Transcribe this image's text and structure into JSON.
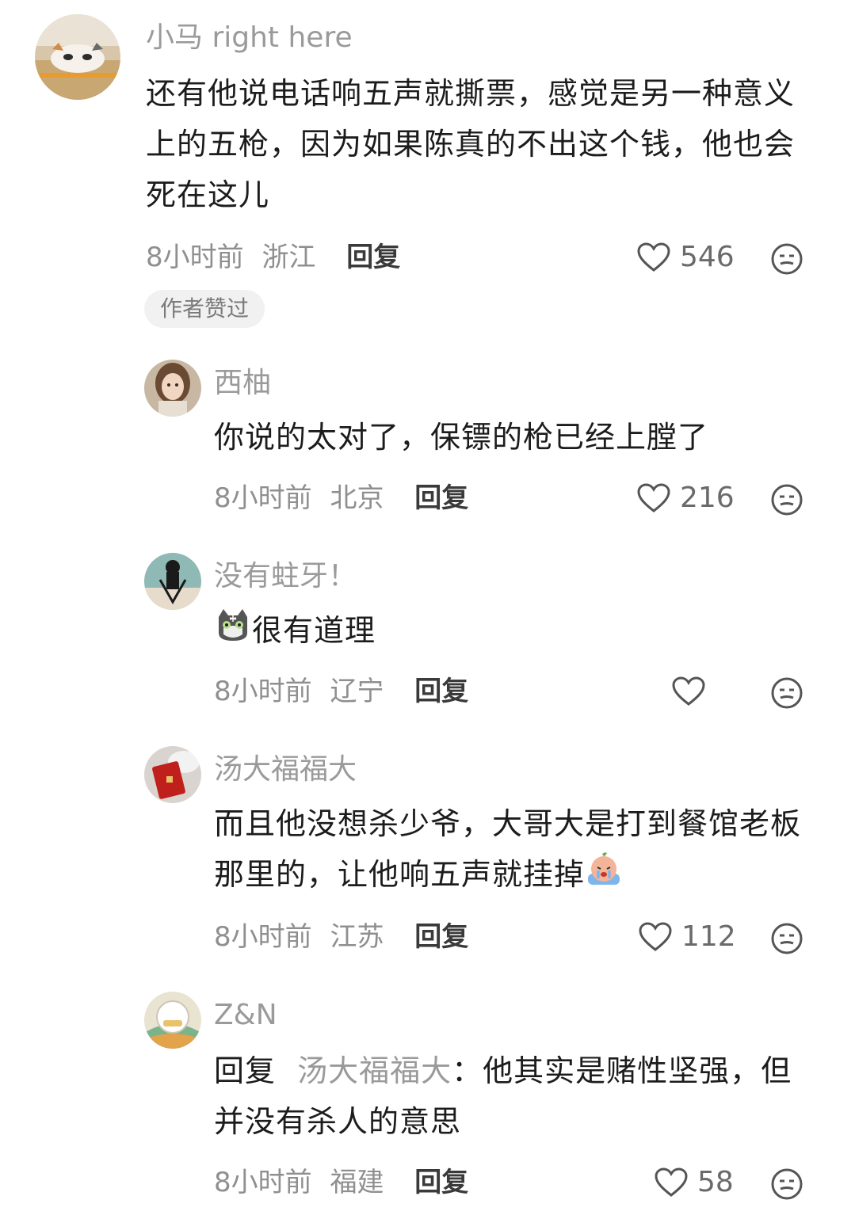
{
  "comments": [
    {
      "username": "小马 right here",
      "text": "还有他说电话响五声就撕票，感觉是另一种意义上的五枪，因为如果陈真的不出这个钱，他也会死在这儿",
      "time": "8小时前",
      "location": "浙江",
      "reply_label": "回复",
      "likes": "546",
      "badge": "作者赞过",
      "avatar_icon": "cat-avatar"
    },
    {
      "username": "西柚",
      "text": "你说的太对了，保镖的枪已经上膛了",
      "time": "8小时前",
      "location": "北京",
      "reply_label": "回复",
      "likes": "216",
      "avatar_icon": "doll-avatar"
    },
    {
      "username": "没有蛀牙！",
      "text": "很有道理",
      "time": "8小时前",
      "location": "辽宁",
      "reply_label": "回复",
      "likes": "",
      "avatar_icon": "cartoon-avatar",
      "emoji": "cat-face-emoji"
    },
    {
      "username": "汤大福福大",
      "text": "而且他没想杀少爷，大哥大是打到餐馆老板那里的，让他响五声就挂掉",
      "time": "8小时前",
      "location": "江苏",
      "reply_label": "回复",
      "likes": "112",
      "avatar_icon": "red-envelope-avatar",
      "emoji": "crying-emoji"
    },
    {
      "username": "Z&N",
      "reply_prefix": "回复",
      "reply_to": "汤大福福大",
      "text": "：他其实是赌性坚强，但并没有杀人的意思",
      "time": "8小时前",
      "location": "福建",
      "reply_label": "回复",
      "likes": "58",
      "avatar_icon": "badge-avatar"
    }
  ]
}
